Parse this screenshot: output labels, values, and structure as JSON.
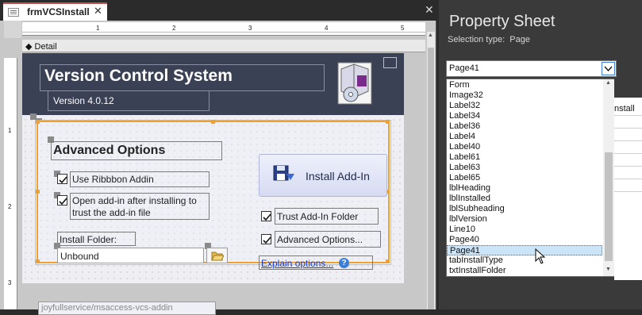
{
  "designer": {
    "tab_title": "frmVCSInstall",
    "tab_close": "✕",
    "pane_close": "✕",
    "section_label": "Detail",
    "ruler_h": [
      "1",
      "2",
      "3",
      "4",
      "5"
    ],
    "ruler_v": [
      "1",
      "2",
      "3"
    ]
  },
  "form": {
    "title": "Version Control System",
    "version": "Version 4.0.12",
    "advanced_title": "Advanced Options",
    "use_ribbon": "Use Ribbbon Addin",
    "open_after_line1": "Open add-in after installing to",
    "open_after_line2": "trust the add-in file",
    "install_folder_label": "Install Folder:",
    "install_folder_value": "Unbound",
    "install_button": "Install Add-In",
    "trust_folder": "Trust Add-In Folder",
    "advanced_options": "Advanced Options...",
    "explain_link": "Explain options...",
    "help_glyph": "?",
    "footer_link": "joyfullservice/msaccess-vcs-addin",
    "checkboxes": {
      "use_ribbon": true,
      "open_after": true,
      "trust_folder": true,
      "advanced": true
    }
  },
  "property_sheet": {
    "title": "Property Sheet",
    "selection_type_label": "Selection type:",
    "selection_type_value": "Page",
    "combo_value": "Page41",
    "grid_header": "nstall",
    "items": [
      "Form",
      "Image32",
      "Label32",
      "Label34",
      "Label36",
      "Label4",
      "Label40",
      "Label61",
      "Label63",
      "Label65",
      "lblHeading",
      "lblInstalled",
      "lblSubheading",
      "lblVersion",
      "Line10",
      "Page40",
      "Page41",
      "tabInstallType",
      "txtInstallFolder"
    ],
    "selected_item": "Page41"
  },
  "icons": {
    "tab_icon": "form-icon",
    "close": "close-icon",
    "section": "section-marker-icon",
    "logo": "installer-box-icon",
    "install": "install-disk-icon",
    "folder": "folder-open-icon",
    "help": "help-icon",
    "dropdown": "chevron-down-icon",
    "cursor": "mouse-pointer-icon"
  },
  "colors": {
    "header": "#3b4155",
    "selection_outline": "#f0a030",
    "link": "#1a3cc8",
    "tab_accent": "#c0504d",
    "list_selection": "#cce4f7"
  }
}
